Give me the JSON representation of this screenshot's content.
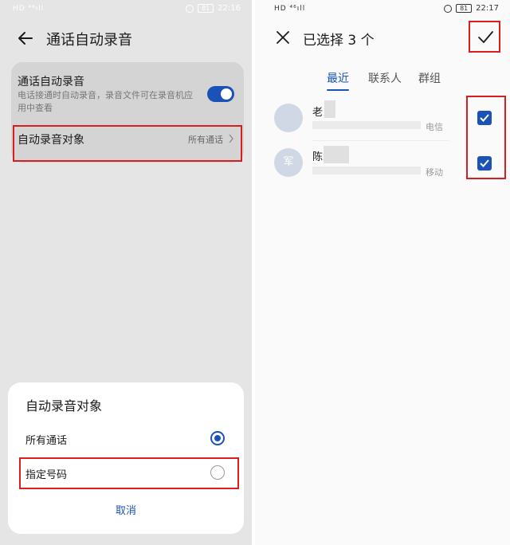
{
  "left_screen": {
    "status": {
      "signal": "HD ⁴⁶ıll",
      "battery": "81",
      "time": "22:16"
    },
    "header": {
      "title": "通话自动录音"
    },
    "setting_auto_record": {
      "title": "通话自动录音",
      "description": "电话接通时自动录音，录音文件可在录音机应用中查看",
      "enabled": true
    },
    "setting_record_target": {
      "title": "自动录音对象",
      "value": "所有通话"
    },
    "sheet": {
      "title": "自动录音对象",
      "options": [
        {
          "label": "所有通话",
          "selected": true
        },
        {
          "label": "指定号码",
          "selected": false
        }
      ],
      "cancel_label": "取消"
    }
  },
  "right_screen": {
    "status": {
      "signal": "HD ⁴⁶ıll",
      "battery": "81",
      "time": "22:17"
    },
    "header": {
      "title": "已选择 3 个"
    },
    "tabs": [
      {
        "label": "最近",
        "active": true
      },
      {
        "label": "联系人",
        "active": false
      },
      {
        "label": "群组",
        "active": false
      }
    ],
    "contacts": [
      {
        "name": "老",
        "avatar": "",
        "carrier": "电信",
        "checked": true
      },
      {
        "name": "陈",
        "avatar": "军",
        "carrier": "移动",
        "checked": true
      }
    ]
  },
  "colors": {
    "accent": "#1b52b8",
    "highlight": "#d81e1e"
  }
}
